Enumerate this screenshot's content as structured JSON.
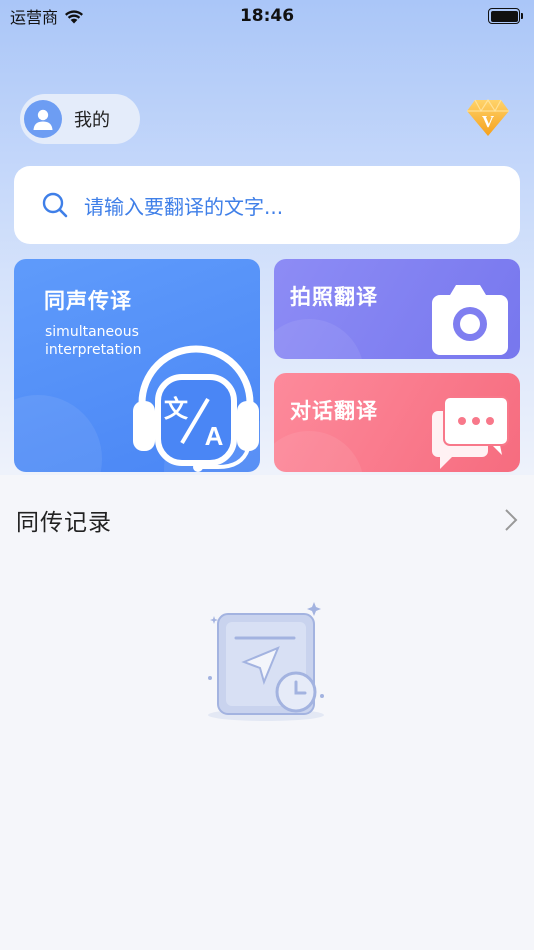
{
  "status_bar": {
    "carrier": "运营商",
    "time": "18:46"
  },
  "profile": {
    "label": "我的"
  },
  "vip": {
    "letter": "V"
  },
  "search": {
    "placeholder": "请输入要翻译的文字..."
  },
  "cards": {
    "simultaneous": {
      "title": "同声传译",
      "subtitle_line1": "simultaneous",
      "subtitle_line2": "interpretation"
    },
    "photo": {
      "title": "拍照翻译"
    },
    "dialog": {
      "title": "对话翻译"
    }
  },
  "history": {
    "title": "同传记录"
  },
  "colors": {
    "accent_blue": "#3f7fe8",
    "card_blue": "#4a86f5",
    "card_purple": "#7f7ef0",
    "card_pink": "#f8788a"
  }
}
